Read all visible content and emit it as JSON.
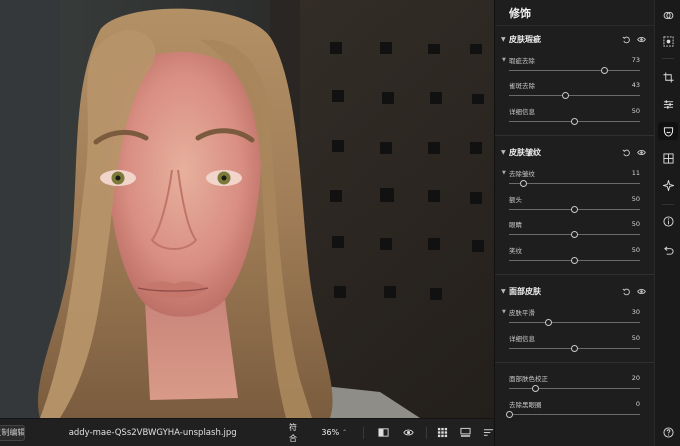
{
  "panel": {
    "title": "修饰",
    "sections": [
      {
        "title": "皮肤瑕疵",
        "sliders": [
          {
            "label": "瑕疵去除",
            "value": "73",
            "level": 0.73,
            "sub": true
          },
          {
            "label": "雀斑去除",
            "value": "43",
            "level": 0.43,
            "sub": false
          },
          {
            "label": "详细信息",
            "value": "50",
            "level": 0.5,
            "sub": false
          }
        ]
      },
      {
        "title": "皮肤皱纹",
        "sliders": [
          {
            "label": "去除皱纹",
            "value": "11",
            "level": 0.11,
            "sub": true
          },
          {
            "label": "额头",
            "value": "50",
            "level": 0.5,
            "sub": false
          },
          {
            "label": "眼睛",
            "value": "50",
            "level": 0.5,
            "sub": false
          },
          {
            "label": "笑纹",
            "value": "50",
            "level": 0.5,
            "sub": false
          }
        ]
      },
      {
        "title": "面部皮肤",
        "sliders": [
          {
            "label": "皮肤平滑",
            "value": "30",
            "level": 0.3,
            "sub": true
          },
          {
            "label": "详细信息",
            "value": "50",
            "level": 0.5,
            "sub": false
          }
        ],
        "extra": [
          {
            "label": "面部肤色校正",
            "value": "20",
            "level": 0.2
          },
          {
            "label": "去除黑眼圈",
            "value": "0",
            "level": 0.0
          }
        ]
      }
    ]
  },
  "toolbar": {
    "copy_label": "复制编辑",
    "filename": "addy-mae-QSs2VBWGYHA-unsplash.jpg",
    "fit_label": "符合",
    "zoom_label": "36%",
    "zoom_caret": "⌃"
  },
  "rail_icons": [
    "layers-icon",
    "selection-icon",
    "crop-icon",
    "adjust-sliders-icon",
    "retouch-face-icon",
    "grid-icon",
    "magic-icon",
    "info-icon",
    "undo-icon",
    "help-icon"
  ],
  "colors": {
    "panel_bg": "#1e1e1e",
    "accent_knob": "#c8c8c8",
    "canvas_bg": "#2e2a27"
  }
}
